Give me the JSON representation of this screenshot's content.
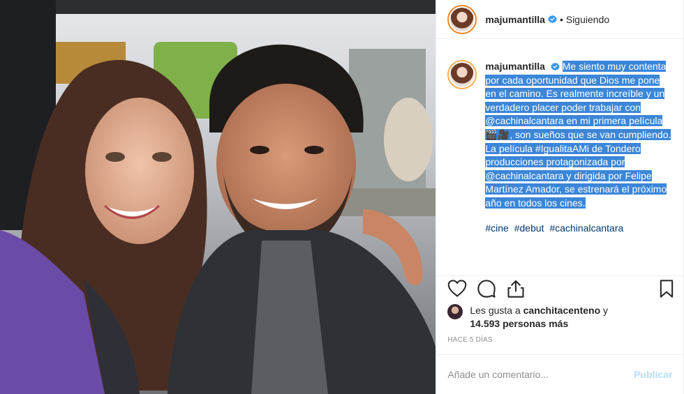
{
  "header": {
    "username": "majumantilla",
    "separator": "•",
    "follow_status": "Siguiendo"
  },
  "caption": {
    "username": "majumantilla",
    "text": "Me siento muy contenta por cada oportunidad que Dios me pone en el camino. Es realmente increíble y un verdadero placer poder trabajar con @cachinalcantara en mi primera película 🎬🎥, son sueños que se van cumpliendo.",
    "text2": "La película #IgualitaAMi de Tondero producciones protagonizada por @cachinalcantara y dirigida por Felipe Martínez Amador, se estrenará el próximo año en todos los cines.",
    "hashtags": [
      "#cine",
      "#debut",
      "#cachinalcantara"
    ]
  },
  "likes": {
    "prefix": "Les gusta a",
    "user": "canchitacenteno",
    "connector": "y",
    "count": "14.593 personas más"
  },
  "timestamp": "HACE 5 DÍAS",
  "comment_box": {
    "placeholder": "Añade un comentario...",
    "submit_label": "Publicar"
  },
  "colors": {
    "highlight": "#3b86d8",
    "hashtag": "#00376b",
    "verified": "#3897f0",
    "publish_disabled": "#b2dffc"
  },
  "icons": [
    "verified-badge-icon",
    "heart-icon",
    "comment-icon",
    "share-icon",
    "bookmark-icon"
  ]
}
